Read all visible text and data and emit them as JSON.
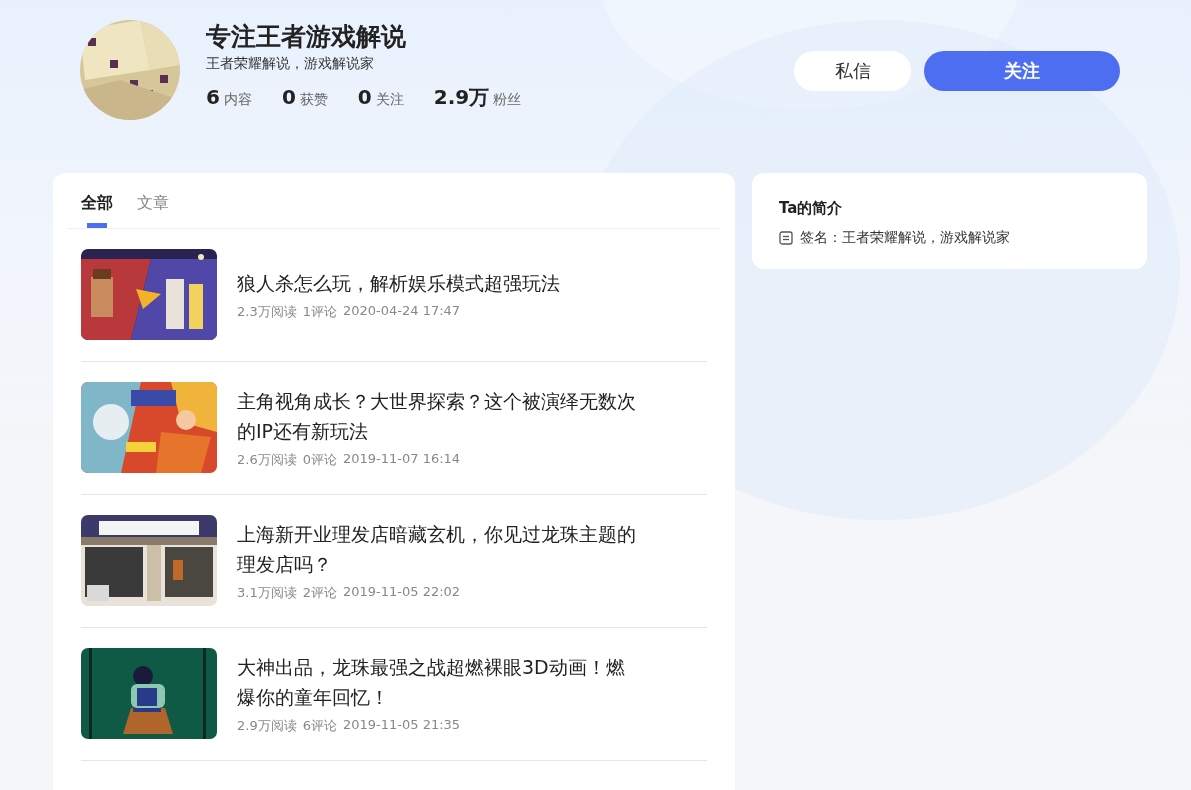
{
  "profile": {
    "name": "专注王者游戏解说",
    "bio": "王者荣耀解说，游戏解说家",
    "stats": [
      {
        "value": "6",
        "label": "内容"
      },
      {
        "value": "0",
        "label": "获赞"
      },
      {
        "value": "0",
        "label": "关注"
      },
      {
        "value": "2.9万",
        "label": "粉丝"
      }
    ],
    "buttons": [
      {
        "label": "私信",
        "kind": "secondary"
      },
      {
        "label": "关注",
        "kind": "primary"
      }
    ]
  },
  "tabs": [
    {
      "label": "全部",
      "selected": true
    },
    {
      "label": "文章",
      "selected": false
    }
  ],
  "articles": [
    {
      "title": "狼人杀怎么玩，解析娱乐模式超强玩法",
      "reads": "2.3万阅读",
      "comments": "1评论",
      "time": "2020-04-24 17:47"
    },
    {
      "title": "主角视角成长？大世界探索？这个被演绎无数次的IP还有新玩法",
      "reads": "2.6万阅读",
      "comments": "0评论",
      "time": "2019-11-07 16:14"
    },
    {
      "title": "上海新开业理发店暗藏玄机，你见过龙珠主题的理发店吗？",
      "reads": "3.1万阅读",
      "comments": "2评论",
      "time": "2019-11-05 22:02"
    },
    {
      "title": "大神出品，龙珠最强之战超燃裸眼3D动画！燃爆你的童年回忆！",
      "reads": "2.9万阅读",
      "comments": "6评论",
      "time": "2019-11-05 21:35"
    }
  ],
  "intro": {
    "title": "Ta的简介",
    "signature": "签名：王者荣耀解说，游戏解说家"
  }
}
